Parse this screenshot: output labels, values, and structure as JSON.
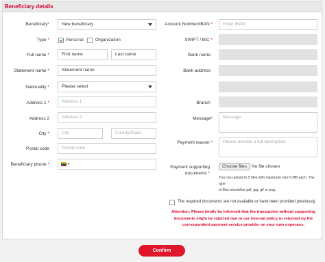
{
  "title": "Beneficiary details",
  "left": {
    "beneficiary_label": "Beneficiary",
    "beneficiary_value": "New beneficiary",
    "type_label": "Type",
    "type_personal": "Personal",
    "type_organization": "Organization",
    "fullname_label": "Full name",
    "firstname_placeholder": "First name",
    "lastname_placeholder": "Last name",
    "statement_label": "Statement name",
    "statement_placeholder": "Statement name",
    "nationality_label": "Nationality",
    "nationality_value": "Please select",
    "address1_label": "Address 1",
    "address1_placeholder": "Address 1",
    "address2_label": "Address 2",
    "address2_placeholder": "Address 2",
    "city_label": "City",
    "city_placeholder": "City",
    "county_placeholder": "County/State",
    "postal_label": "Postal code",
    "postal_placeholder": "Postal code",
    "phone_label": "Beneficiary phone"
  },
  "right": {
    "account_label": "Account Number/IBAN",
    "account_placeholder": "Enter IBAN",
    "swift_label": "SWIFT / BIC",
    "bank_name_label": "Bank name",
    "bank_address_label": "Bank address",
    "branch_label": "Branch",
    "message_label": "Message",
    "message_placeholder": "Message",
    "reason_label": "Payment reason",
    "reason_placeholder": "Please provide a full description",
    "docs_label_1": "Payment supporting",
    "docs_label_2": "documents",
    "choose_files": "Choose files",
    "no_file": "No file chosen",
    "upload_note_1": "You can upload to 5 files with maximum size 5 MB each. The type",
    "upload_note_2": "of files should be pdf, jpg, gif or png."
  },
  "required_asterisk": "*",
  "docs_checkbox_text": "The required documents are not available or have been provided previously.",
  "attention_1": "Attention: Please kindly be informed that the transaction without supporting",
  "attention_2": "documents might be rejected due to our internal policy or returned by the",
  "attention_3": "correspondent payment service provider on your own expenses.",
  "confirm_label": "Confirm",
  "colors": {
    "accent": "#d4002a",
    "button": "#e0162b"
  }
}
